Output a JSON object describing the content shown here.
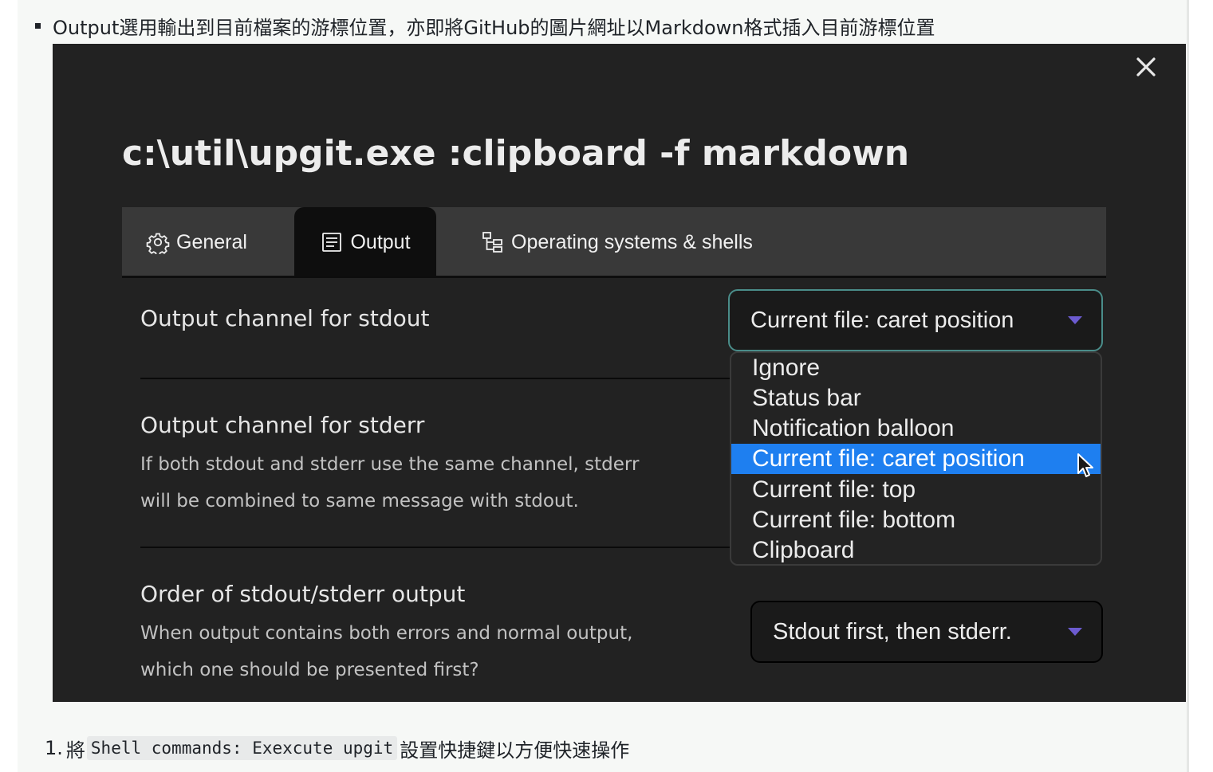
{
  "article": {
    "bullet_text": "Output選用輸出到目前檔案的游標位置，亦即將GitHub的圖片網址以Markdown格式插入目前游標位置",
    "step": {
      "number": "1.",
      "prefix": "將",
      "code": "Shell commands: Exexcute upgit",
      "suffix": "設置快捷鍵以方便快速操作"
    }
  },
  "dialog": {
    "title": "c:\\util\\upgit.exe :clipboard -f markdown",
    "close_icon": "close-icon",
    "tabs": [
      {
        "label": "General",
        "icon": "gear-icon"
      },
      {
        "label": "Output",
        "icon": "document-lines-icon",
        "active": true
      },
      {
        "label": "Operating systems & shells",
        "icon": "tree-hierarchy-icon"
      }
    ],
    "settings": {
      "stdout": {
        "label": "Output channel for stdout",
        "selected": "Current file: caret position",
        "options": [
          "Ignore",
          "Status bar",
          "Notification balloon",
          "Current file: caret position",
          "Current file: top",
          "Current file: bottom",
          "Clipboard"
        ],
        "highlighted_index": 3
      },
      "stderr": {
        "label": "Output channel for stderr",
        "desc_line1": "If both stdout and stderr use the same channel, stderr",
        "desc_line2": "will be combined to same message with stdout."
      },
      "order": {
        "label": "Order of stdout/stderr output",
        "desc_line1": "When output contains both errors and normal output,",
        "desc_line2": "which one should be presented first?",
        "selected": "Stdout first, then stderr."
      }
    }
  },
  "colors": {
    "dialog_bg": "#222222",
    "tab_bar": "#393939",
    "active_tab": "#0e0e0e",
    "select_border_focus": "#4a8d8a",
    "dropdown_arrow": "#6c5bd0",
    "selected_option": "#1e7ff0",
    "page_bg": "#f6f8f6"
  }
}
